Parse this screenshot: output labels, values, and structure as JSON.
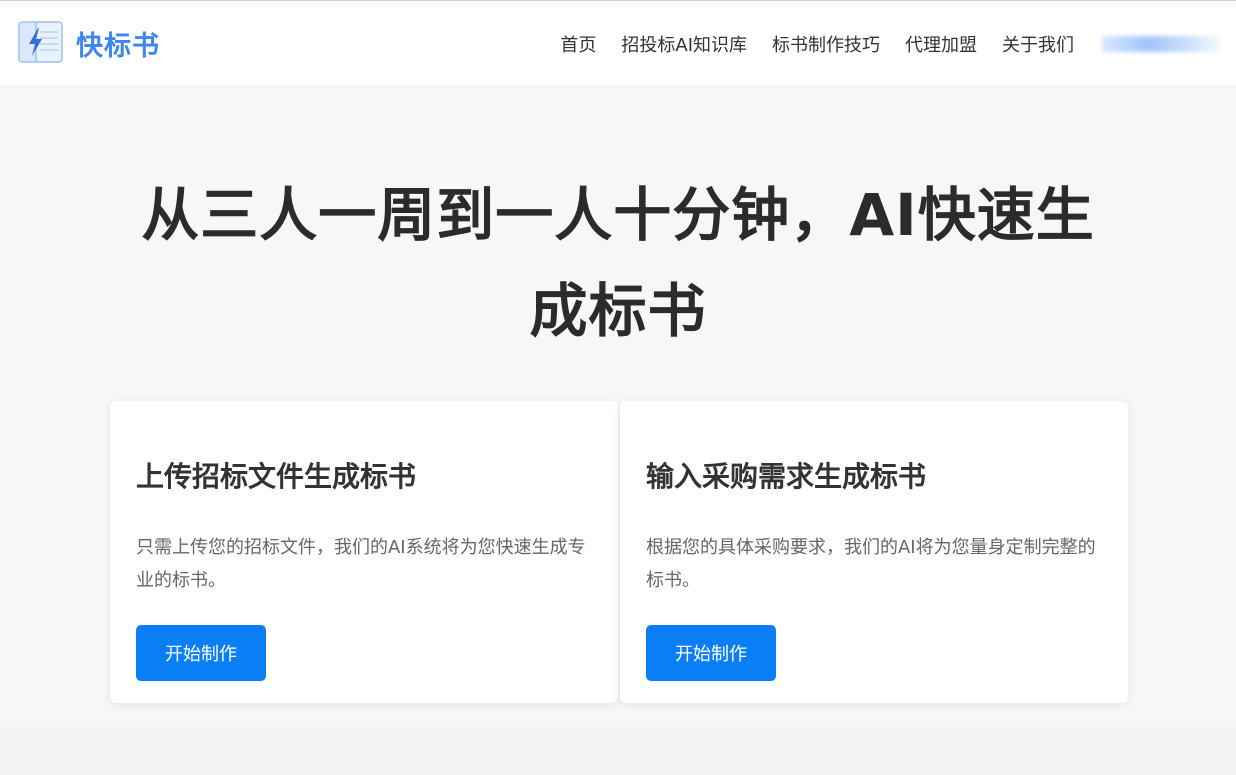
{
  "brand": {
    "name": "快标书",
    "logo_icon": "document-lightning-icon",
    "accent_color": "#3d86f0"
  },
  "nav": {
    "items": [
      {
        "label": "首页"
      },
      {
        "label": "招投标AI知识库"
      },
      {
        "label": "标书制作技巧"
      },
      {
        "label": "代理加盟"
      },
      {
        "label": "关于我们"
      }
    ]
  },
  "hero": {
    "title": "从三人一周到一人十分钟，AI快速生成标书"
  },
  "cards": [
    {
      "title": "上传招标文件生成标书",
      "description": "只需上传您的招标文件，我们的AI系统将为您快速生成专业的标书。",
      "button": "开始制作"
    },
    {
      "title": "输入采购需求生成标书",
      "description": "根据您的具体采购要求，我们的AI将为您量身定制完整的标书。",
      "button": "开始制作"
    }
  ],
  "colors": {
    "button_bg": "#0a7ff5",
    "page_bg": "#f7f7f7"
  }
}
